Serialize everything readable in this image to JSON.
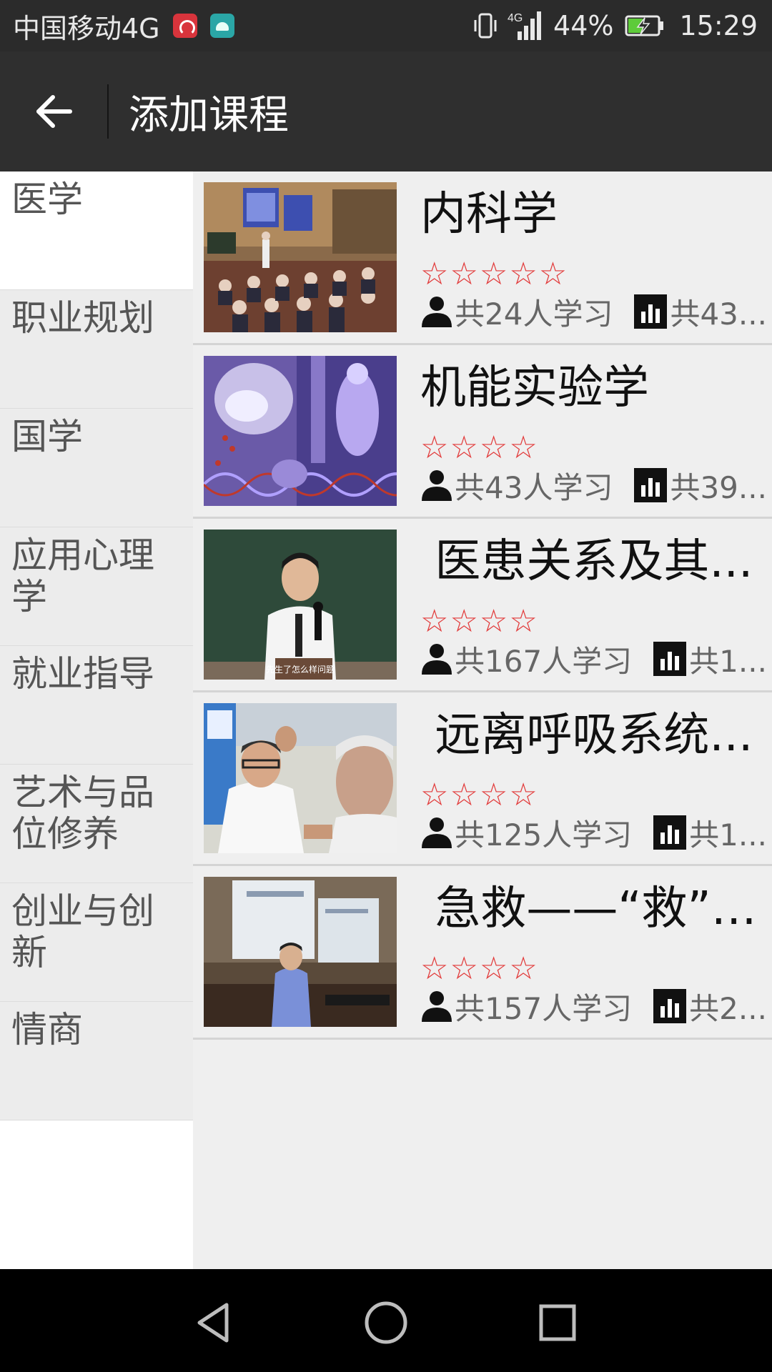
{
  "status_bar": {
    "carrier": "中国移动4G",
    "network_label": "4G",
    "battery_percent": "44%",
    "time": "15:29"
  },
  "header": {
    "title": "添加课程"
  },
  "categories": [
    {
      "label": "医学",
      "active": true
    },
    {
      "label": "职业规划"
    },
    {
      "label": "国学"
    },
    {
      "label": "应用心理学"
    },
    {
      "label": "就业指导"
    },
    {
      "label": "艺术与品位修养"
    },
    {
      "label": "创业与创新"
    },
    {
      "label": "情商"
    }
  ],
  "courses": [
    {
      "title": "内科学",
      "stars": "☆☆☆☆☆",
      "learners": "共24人学习",
      "lessons": "共43..."
    },
    {
      "title": "机能实验学",
      "stars": "☆☆☆☆",
      "learners": "共43人学习",
      "lessons": "共39..."
    },
    {
      "title": " 医患关系及其...",
      "stars": "☆☆☆☆",
      "learners": "共167人学习",
      "lessons": "共1..."
    },
    {
      "title": " 远离呼吸系统...",
      "stars": "☆☆☆☆",
      "learners": "共125人学习",
      "lessons": "共1..."
    },
    {
      "title": " 急救——“救”在...",
      "stars": "☆☆☆☆",
      "learners": "共157人学习",
      "lessons": "共2..."
    }
  ],
  "thumbnails": [
    {
      "subtitle": ""
    },
    {
      "subtitle": ""
    },
    {
      "subtitle": "先生了怎么样问题"
    },
    {
      "subtitle": ""
    },
    {
      "subtitle": ""
    }
  ],
  "colors": {
    "status_bar_bg": "#2b2b2b",
    "header_bg": "#2f2f2f",
    "star_red": "#e23a3a",
    "active_category_bg": "#ffffff",
    "category_bg": "#ececec"
  },
  "icons": {
    "back": "arrow-left-icon",
    "person": "person-icon",
    "stats": "bar-chart-icon",
    "nav_back": "triangle-back-icon",
    "nav_home": "circle-home-icon",
    "nav_recents": "square-recents-icon"
  }
}
